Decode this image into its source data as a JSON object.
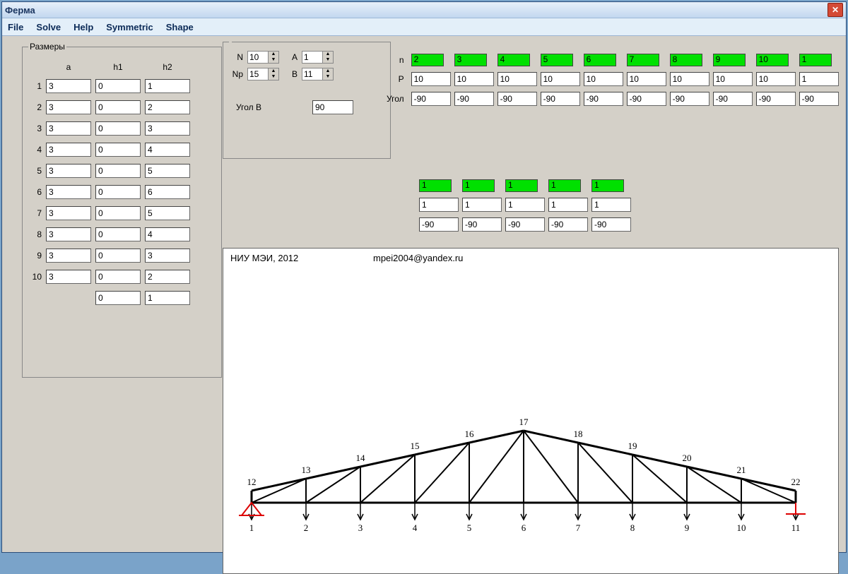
{
  "window": {
    "title": "Ферма"
  },
  "menu": {
    "file": "File",
    "solve": "Solve",
    "help": "Help",
    "symmetric": "Symmetric",
    "shape": "Shape"
  },
  "sizes": {
    "legend": "Размеры",
    "head_a": "a",
    "head_h1": "h1",
    "head_h2": "h2",
    "rows": [
      {
        "i": "1",
        "a": "3",
        "h1": "0",
        "h2": "1"
      },
      {
        "i": "2",
        "a": "3",
        "h1": "0",
        "h2": "2"
      },
      {
        "i": "3",
        "a": "3",
        "h1": "0",
        "h2": "3"
      },
      {
        "i": "4",
        "a": "3",
        "h1": "0",
        "h2": "4"
      },
      {
        "i": "5",
        "a": "3",
        "h1": "0",
        "h2": "5"
      },
      {
        "i": "6",
        "a": "3",
        "h1": "0",
        "h2": "6"
      },
      {
        "i": "7",
        "a": "3",
        "h1": "0",
        "h2": "5"
      },
      {
        "i": "8",
        "a": "3",
        "h1": "0",
        "h2": "4"
      },
      {
        "i": "9",
        "a": "3",
        "h1": "0",
        "h2": "3"
      },
      {
        "i": "10",
        "a": "3",
        "h1": "0",
        "h2": "2"
      }
    ],
    "extra_h1": "0",
    "extra_h2": "1"
  },
  "params": {
    "N_label": "N",
    "N": "10",
    "Np_label": "Np",
    "Np": "15",
    "A_label": "A",
    "A": "1",
    "B_label": "B",
    "B": "11",
    "angleB_label": "Угол B",
    "angleB": "90"
  },
  "loads": {
    "n_label": "n",
    "P_label": "P",
    "angle_label": "Угол",
    "n": [
      "2",
      "3",
      "4",
      "5",
      "6",
      "7",
      "8",
      "9",
      "10",
      "1"
    ],
    "P": [
      "10",
      "10",
      "10",
      "10",
      "10",
      "10",
      "10",
      "10",
      "10",
      "1"
    ],
    "angle": [
      "-90",
      "-90",
      "-90",
      "-90",
      "-90",
      "-90",
      "-90",
      "-90",
      "-90",
      "-90"
    ]
  },
  "loads2": {
    "n": [
      "1",
      "1",
      "1",
      "1",
      "1"
    ],
    "P": [
      "1",
      "1",
      "1",
      "1",
      "1"
    ],
    "angle": [
      "-90",
      "-90",
      "-90",
      "-90",
      "-90"
    ]
  },
  "canvas": {
    "org": "НИУ МЭИ, 2012",
    "email": "mpei2004@yandex.ru"
  },
  "nodes_bottom": [
    "1",
    "2",
    "3",
    "4",
    "5",
    "6",
    "7",
    "8",
    "9",
    "10",
    "11"
  ],
  "nodes_top": [
    "12",
    "13",
    "14",
    "15",
    "16",
    "17",
    "18",
    "19",
    "20",
    "21",
    "22"
  ]
}
